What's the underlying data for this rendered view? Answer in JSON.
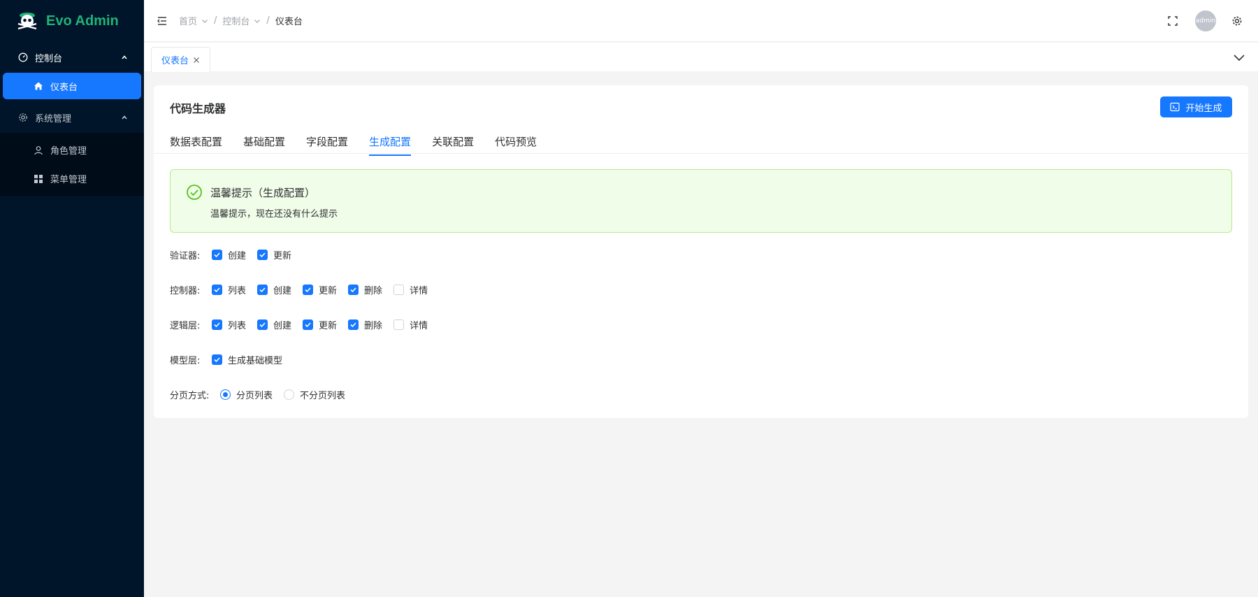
{
  "app": {
    "name": "Evo Admin"
  },
  "colors": {
    "primary": "#1677ff",
    "sidebar": "#001529",
    "brand": "#1fb37a",
    "success": "#52c41a"
  },
  "sidebar": {
    "groups": [
      {
        "label": "控制台",
        "icon": "dashboard-icon",
        "items": [
          {
            "label": "仪表台",
            "icon": "home-icon",
            "active": true
          }
        ]
      },
      {
        "label": "系统管理",
        "icon": "gear-icon",
        "items": [
          {
            "label": "角色管理",
            "icon": "user-icon"
          },
          {
            "label": "菜单管理",
            "icon": "grid-icon"
          }
        ]
      }
    ]
  },
  "header": {
    "breadcrumb": [
      {
        "label": "首页"
      },
      {
        "label": "控制台"
      },
      {
        "label": "仪表台"
      }
    ],
    "separator": "/",
    "avatar": "admin"
  },
  "tabs": [
    {
      "label": "仪表台"
    }
  ],
  "card": {
    "title": "代码生成器",
    "action_label": "开始生成",
    "subtabs": [
      "数据表配置",
      "基础配置",
      "字段配置",
      "生成配置",
      "关联配置",
      "代码预览"
    ],
    "active_subtab": "生成配置",
    "alert": {
      "title": "温馨提示（生成配置）",
      "desc": "温馨提示，现在还没有什么提示"
    },
    "form": {
      "validator": {
        "label": "验证器:",
        "options": [
          {
            "label": "创建",
            "checked": true
          },
          {
            "label": "更新",
            "checked": true
          }
        ]
      },
      "controller": {
        "label": "控制器:",
        "options": [
          {
            "label": "列表",
            "checked": true
          },
          {
            "label": "创建",
            "checked": true
          },
          {
            "label": "更新",
            "checked": true
          },
          {
            "label": "删除",
            "checked": true
          },
          {
            "label": "详情",
            "checked": false
          }
        ]
      },
      "logic": {
        "label": "逻辑层:",
        "options": [
          {
            "label": "列表",
            "checked": true
          },
          {
            "label": "创建",
            "checked": true
          },
          {
            "label": "更新",
            "checked": true
          },
          {
            "label": "删除",
            "checked": true
          },
          {
            "label": "详情",
            "checked": false
          }
        ]
      },
      "model": {
        "label": "模型层:",
        "options": [
          {
            "label": "生成基础模型",
            "checked": true
          }
        ]
      },
      "paging": {
        "label": "分页方式:",
        "options": [
          {
            "label": "分页列表",
            "selected": true
          },
          {
            "label": "不分页列表",
            "selected": false
          }
        ]
      }
    }
  }
}
